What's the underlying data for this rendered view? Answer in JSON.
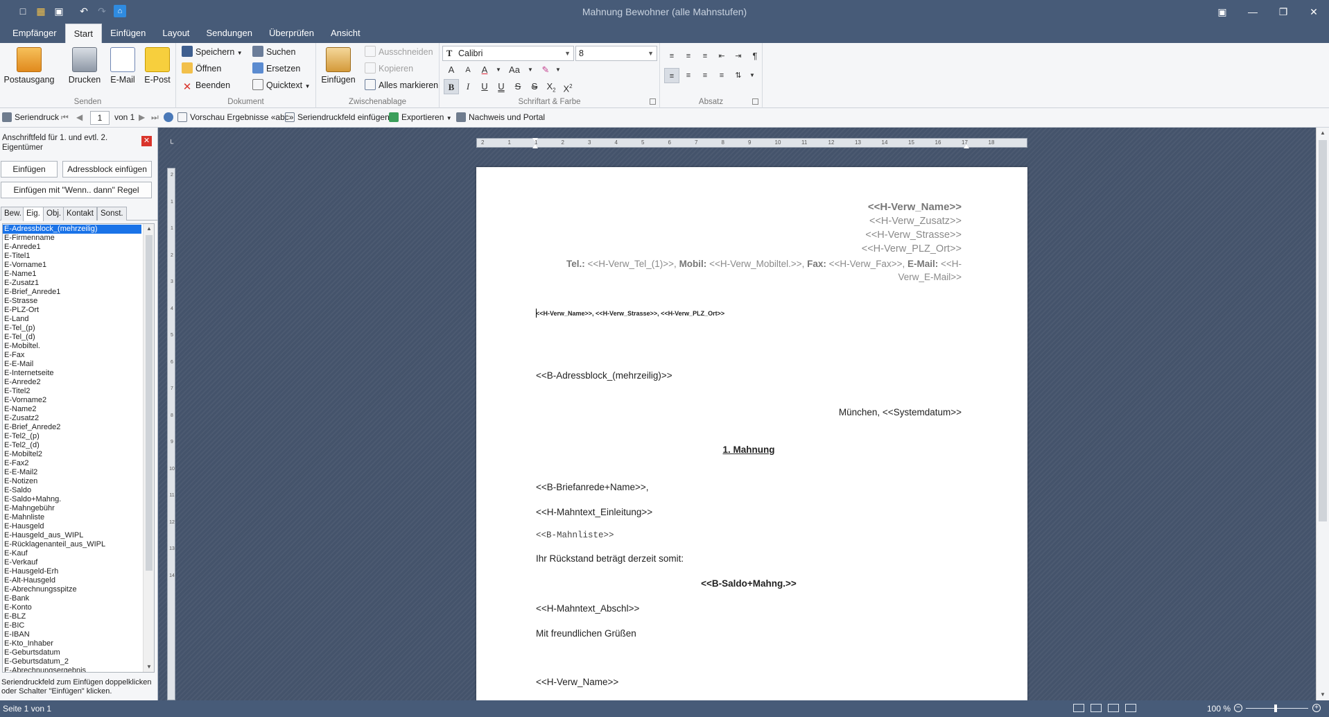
{
  "window": {
    "title": "Mahnung Bewohner (alle Mahnstufen)"
  },
  "tabs": [
    "Empfänger",
    "Start",
    "Einfügen",
    "Layout",
    "Sendungen",
    "Überprüfen",
    "Ansicht"
  ],
  "ribbon": {
    "send": {
      "label": "Senden",
      "postausgang": "Postausgang"
    },
    "doc_big": {
      "drucken": "Drucken",
      "email": "E-Mail",
      "epost": "E-Post"
    },
    "document": {
      "label": "Dokument",
      "speichern": "Speichern",
      "oeffnen": "Öffnen",
      "beenden": "Beenden",
      "suchen": "Suchen",
      "ersetzen": "Ersetzen",
      "quicktext": "Quicktext"
    },
    "clipboard": {
      "label": "Zwischenablage",
      "einfuegen": "Einfügen",
      "ausschneiden": "Ausschneiden",
      "kopieren": "Kopieren",
      "alles_markieren": "Alles markieren"
    },
    "font": {
      "label": "Schriftart & Farbe",
      "family": "Calibri",
      "size": "8"
    },
    "paragraph": {
      "label": "Absatz"
    }
  },
  "mailmerge": {
    "seriendruck": "Seriendruck",
    "page": "1",
    "of": "von 1",
    "vorschau": "Vorschau Ergebnisse «abc»",
    "feld_einfuegen": "Seriendruckfeld einfügen",
    "exportieren": "Exportieren",
    "nachweis": "Nachweis und Portal"
  },
  "leftpanel": {
    "header": "Anschriftfeld für 1. und evtl. 2. Eigentümer",
    "btn_einfuegen": "Einfügen",
    "btn_adressblock": "Adressblock einfügen",
    "btn_regel": "Einfügen mit \"Wenn.. dann\" Regel",
    "tabs": [
      "Bew.",
      "Eig.",
      "Obj.",
      "Kontakt",
      "Sonst."
    ],
    "active_tab": 1,
    "fields": [
      "E-Adressblock_(mehrzeilig)",
      "E-Firmenname",
      "E-Anrede1",
      "E-Titel1",
      "E-Vorname1",
      "E-Name1",
      "E-Zusatz1",
      "E-Brief_Anrede1",
      "E-Strasse",
      "E-PLZ-Ort",
      "E-Land",
      "E-Tel_(p)",
      "E-Tel_(d)",
      "E-Mobiltel.",
      "E-Fax",
      "E-E-Mail",
      "E-Internetseite",
      "E-Anrede2",
      "E-Titel2",
      "E-Vorname2",
      "E-Name2",
      "E-Zusatz2",
      "E-Brief_Anrede2",
      "E-Tel2_(p)",
      "E-Tel2_(d)",
      "E-Mobiltel2",
      "E-Fax2",
      "E-E-Mail2",
      "E-Notizen",
      "E-Saldo",
      "E-Saldo+Mahng.",
      "E-Mahngebühr",
      "E-Mahnliste",
      "E-Hausgeld",
      "E-Hausgeld_aus_WIPL",
      "E-Rücklagenanteil_aus_WIPL",
      "E-Kauf",
      "E-Verkauf",
      "E-Hausgeld-Erh",
      "E-Alt-Hausgeld",
      "E-Abrechnungsspitze",
      "E-Bank",
      "E-Konto",
      "E-BLZ",
      "E-BIC",
      "E-IBAN",
      "E-Kto_Inhaber",
      "E-Geburtsdatum",
      "E-Geburtsdatum_2",
      "E-Abrechnungsergebnis"
    ],
    "hint": "Seriendruckfeld zum Einfügen doppelklicken oder Schalter \"Einfügen\" klicken."
  },
  "ruler": {
    "h_ticks": [
      "2",
      "1",
      "1",
      "2",
      "3",
      "4",
      "5",
      "6",
      "7",
      "8",
      "9",
      "10",
      "11",
      "12",
      "13",
      "14",
      "15",
      "16",
      "17",
      "18"
    ],
    "v_ticks": [
      "2",
      "1",
      "1",
      "2",
      "3",
      "4",
      "5",
      "6",
      "7",
      "8",
      "9",
      "10",
      "11",
      "12",
      "13",
      "14"
    ]
  },
  "document": {
    "verw_name": "<<H-Verw_Name>>",
    "verw_zusatz": "<<H-Verw_Zusatz>>",
    "verw_strasse": "<<H-Verw_Strasse>>",
    "verw_plz_ort": "<<H-Verw_PLZ_Ort>>",
    "tel_label": "Tel.:",
    "tel_value": " <<H-Verw_Tel_(1)>>, ",
    "mobil_label": "Mobil:",
    "mobil_value": " <<H-Verw_Mobiltel.>>, ",
    "fax_label": "Fax:",
    "fax_value": " <<H-Verw_Fax>>, ",
    "email_label": "E-Mail:",
    "email_value": " <<H-Verw_E-Mail>>",
    "sender_line": "<<H-Verw_Name>>, <<H-Verw_Strasse>>, <<H-Verw_PLZ_Ort>>",
    "adressblock": "<<B-Adressblock_(mehrzeilig)>>",
    "datum": "München, <<Systemdatum>>",
    "betreff": "1. Mahnung",
    "anrede": "<<B-Briefanrede+Name>>,",
    "einleitung": "<<H-Mahntext_Einleitung>>",
    "mahnliste": "<<B-Mahnliste>>",
    "rueckstand": "Ihr Rückstand beträgt derzeit somit:",
    "saldo": "<<B-Saldo+Mahng.>>",
    "abschluss": "<<H-Mahntext_Abschl>>",
    "gruss": "Mit freundlichen Grüßen",
    "unterschrift": "<<H-Verw_Name>>"
  },
  "status": {
    "page": "Seite 1 von 1",
    "zoom": "100 %",
    "zoom_percent": 100
  },
  "colors": {
    "frame": "#475b78",
    "ribbon": "#f5f6f8",
    "selection": "#1a73e8",
    "doc_bg": "#44536b"
  }
}
